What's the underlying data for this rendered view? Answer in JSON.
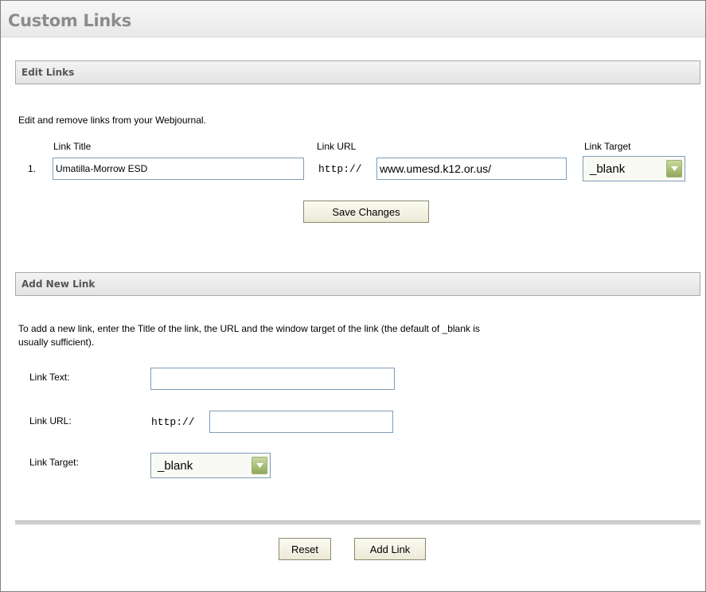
{
  "header": {
    "title": "Custom Links"
  },
  "edit_section": {
    "heading": "Edit Links",
    "intro": "Edit and remove links from your Webjournal.",
    "col_title": "Link Title",
    "col_url": "Link URL",
    "col_target": "Link Target",
    "rows": [
      {
        "index": "1.",
        "title": "Umatilla-Morrow ESD",
        "url_prefix": "http://",
        "url": "www.umesd.k12.or.us/",
        "target": "_blank"
      }
    ],
    "save_label": "Save Changes"
  },
  "add_section": {
    "heading": "Add New Link",
    "intro_line1": "To add a new link, enter the Title of the link, the URL and the window target of the link (the default of _blank is",
    "intro_line2": "usually sufficient).",
    "text_label": "Link Text:",
    "text_value": "",
    "url_label": "Link URL:",
    "url_prefix": "http://",
    "url_value": "",
    "target_label": "Link Target:",
    "target_value": "_blank"
  },
  "footer": {
    "reset_label": "Reset",
    "add_label": "Add Link"
  }
}
